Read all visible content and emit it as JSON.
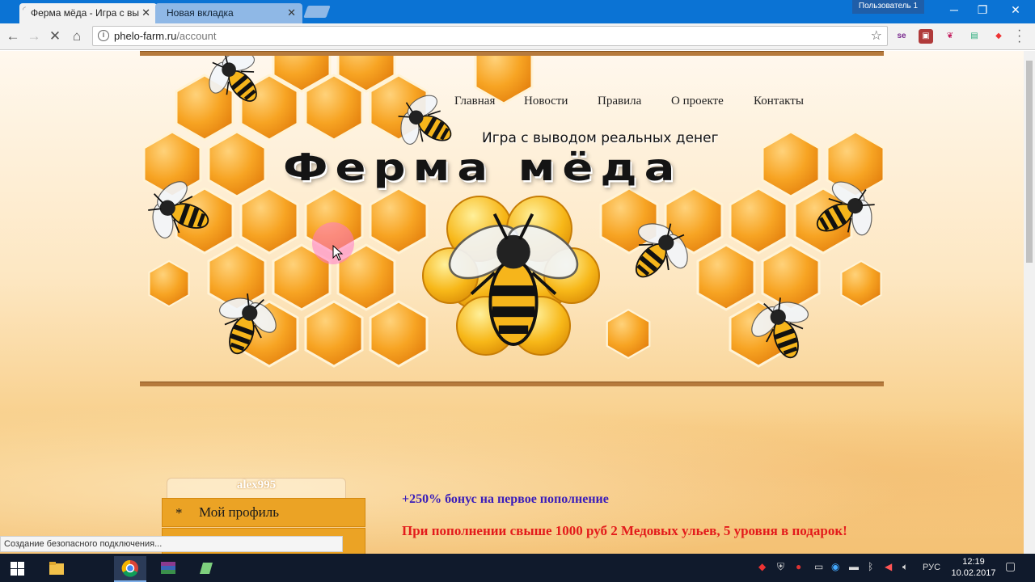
{
  "browser": {
    "tabs": [
      {
        "label": "Ферма мёда - Игра с вы",
        "active": true
      },
      {
        "label": "Новая вкладка",
        "active": false
      }
    ],
    "user_badge": "Пользователь 1",
    "url_host": "phelo-farm.ru",
    "url_path": "/account",
    "status_text": "Создание безопасного подключения..."
  },
  "site": {
    "nav": [
      "Главная",
      "Новости",
      "Правила",
      "О проекте",
      "Контакты"
    ],
    "slogan": "Игра с выводом реальных денег",
    "logo": "Ферма мёда",
    "sidebar": {
      "username": "alex995",
      "items": [
        {
          "bullet": "*",
          "label": "Мой профиль"
        }
      ]
    },
    "promo": {
      "bonus": "+250% бонус на первое пополнение",
      "gift": "При пополнении свыше 1000 руб 2 Медовых ульев, 5 уровня в подарок!"
    }
  },
  "taskbar": {
    "lang": "РУС",
    "time": "12:19",
    "date": "10.02.2017"
  },
  "colors": {
    "chrome_blue": "#0b73d4",
    "honey": "#f39a1c",
    "menu_orange": "#eba325",
    "promo_blue": "#3a1db9",
    "promo_red": "#e31b1b"
  }
}
